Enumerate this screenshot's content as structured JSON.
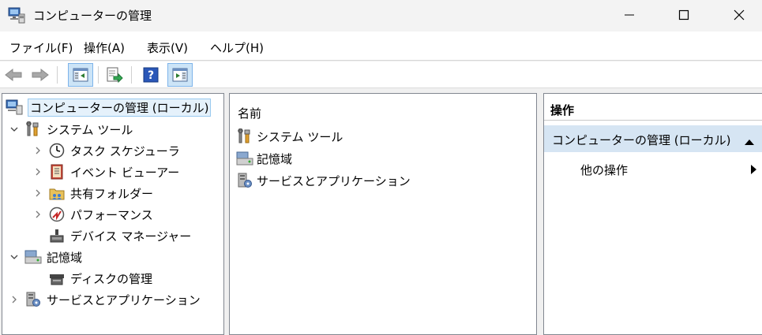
{
  "window": {
    "title": "コンピューターの管理",
    "icon": "computer-management-icon"
  },
  "menu": [
    {
      "label": "ファイル(F)"
    },
    {
      "label": "操作(A)"
    },
    {
      "label": "表示(V)"
    },
    {
      "label": "ヘルプ(H)"
    }
  ],
  "toolbar": {
    "buttons": [
      {
        "icon": "back-arrow-icon"
      },
      {
        "icon": "forward-arrow-icon"
      },
      {
        "icon": "show-hide-console-tree-icon",
        "pressed": true
      },
      {
        "icon": "export-list-icon"
      },
      {
        "icon": "help-icon"
      },
      {
        "icon": "show-hide-action-pane-icon",
        "pressed": true
      }
    ]
  },
  "tree": {
    "root": {
      "label": "コンピューターの管理 (ローカル)"
    },
    "items": [
      {
        "label": "システム ツール",
        "level": 1,
        "expanded": true
      },
      {
        "label": "タスク スケジューラ",
        "level": 2,
        "expanded": false
      },
      {
        "label": "イベント ビューアー",
        "level": 2,
        "expanded": false
      },
      {
        "label": "共有フォルダー",
        "level": 2,
        "expanded": false
      },
      {
        "label": "パフォーマンス",
        "level": 2,
        "expanded": false
      },
      {
        "label": "デバイス マネージャー",
        "level": 2
      },
      {
        "label": "記憶域",
        "level": 1,
        "expanded": true
      },
      {
        "label": "ディスクの管理",
        "level": 2
      },
      {
        "label": "サービスとアプリケーション",
        "level": 1,
        "expanded": false
      }
    ]
  },
  "list": {
    "column": "名前",
    "items": [
      {
        "label": "システム ツール"
      },
      {
        "label": "記憶域"
      },
      {
        "label": "サービスとアプリケーション"
      }
    ]
  },
  "actions": {
    "header": "操作",
    "section": "コンピューターの管理 (ローカル)",
    "item": "他の操作"
  }
}
